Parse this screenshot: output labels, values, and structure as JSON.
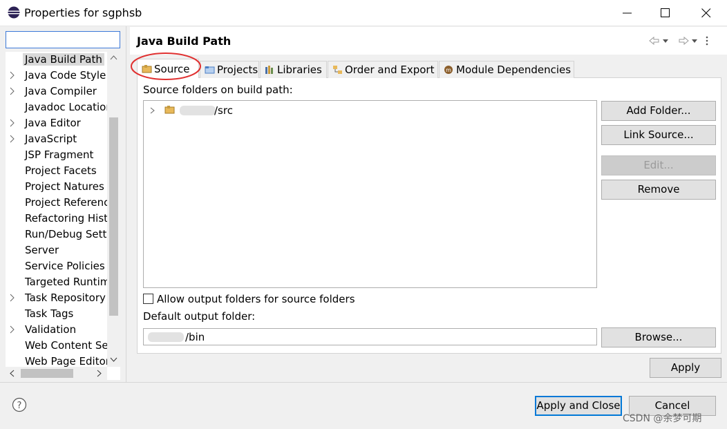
{
  "window": {
    "title": "Properties for sgphsb",
    "controls": [
      "minimize-icon",
      "maximize-icon",
      "close-icon"
    ]
  },
  "filter": {
    "value": "",
    "placeholder": ""
  },
  "tree": {
    "items": [
      {
        "label": "Java Build Path",
        "expandable": false,
        "selected": true
      },
      {
        "label": "Java Code Style",
        "expandable": true
      },
      {
        "label": "Java Compiler",
        "expandable": true
      },
      {
        "label": "Javadoc Location",
        "expandable": false
      },
      {
        "label": "Java Editor",
        "expandable": true
      },
      {
        "label": "JavaScript",
        "expandable": true
      },
      {
        "label": "JSP Fragment",
        "expandable": false
      },
      {
        "label": "Project Facets",
        "expandable": false
      },
      {
        "label": "Project Natures",
        "expandable": false
      },
      {
        "label": "Project References",
        "expandable": false
      },
      {
        "label": "Refactoring History",
        "expandable": false
      },
      {
        "label": "Run/Debug Settings",
        "expandable": false
      },
      {
        "label": "Server",
        "expandable": false
      },
      {
        "label": "Service Policies",
        "expandable": false
      },
      {
        "label": "Targeted Runtimes",
        "expandable": false
      },
      {
        "label": "Task Repository",
        "expandable": true
      },
      {
        "label": "Task Tags",
        "expandable": false
      },
      {
        "label": "Validation",
        "expandable": true
      },
      {
        "label": "Web Content Settings",
        "expandable": false
      },
      {
        "label": "Web Page Editor",
        "expandable": false
      }
    ]
  },
  "page": {
    "title": "Java Build Path"
  },
  "tabs": [
    {
      "label": "Source",
      "icon": "source-folder-icon",
      "active": true
    },
    {
      "label": "Projects",
      "icon": "projects-icon"
    },
    {
      "label": "Libraries",
      "icon": "libraries-icon"
    },
    {
      "label": "Order and Export",
      "icon": "order-export-icon"
    },
    {
      "label": "Module Dependencies",
      "icon": "module-icon"
    }
  ],
  "source": {
    "list_label": "Source folders on build path:",
    "folders": [
      {
        "suffix": "/src"
      }
    ],
    "allow_output_label": "Allow output folders for source folders",
    "allow_output_checked": false,
    "output_label": "Default output folder:",
    "output_suffix": "/bin"
  },
  "buttons": {
    "add_folder": "Add Folder...",
    "link_source": "Link Source...",
    "edit": "Edit...",
    "remove": "Remove",
    "browse": "Browse...",
    "apply": "Apply",
    "apply_close": "Apply and Close",
    "cancel": "Cancel"
  },
  "watermark": "CSDN @余梦可期",
  "colors": {
    "highlight_circle": "#e03030",
    "focus_border": "#0078d7"
  }
}
